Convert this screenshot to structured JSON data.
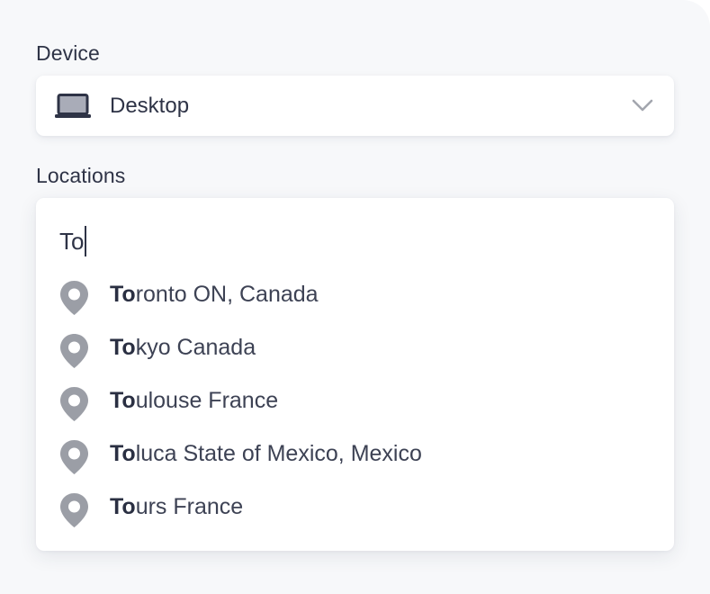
{
  "device": {
    "label": "Device",
    "selected": "Desktop",
    "icon": "laptop-icon",
    "dropdown_icon": "chevron-down-icon"
  },
  "locations": {
    "label": "Locations",
    "query": "To",
    "suggestions": [
      {
        "match": "To",
        "rest": "ronto ON, Canada"
      },
      {
        "match": "To",
        "rest": "kyo Canada"
      },
      {
        "match": "To",
        "rest": "ulouse France"
      },
      {
        "match": "To",
        "rest": "luca State of Mexico, Mexico"
      },
      {
        "match": "To",
        "rest": "urs France"
      }
    ],
    "suggestion_icon": "location-pin-icon"
  },
  "colors": {
    "text": "#2e3346",
    "icon_gray": "#9b9ea6",
    "panel_bg": "#f7f8fa",
    "card_bg": "#ffffff"
  }
}
